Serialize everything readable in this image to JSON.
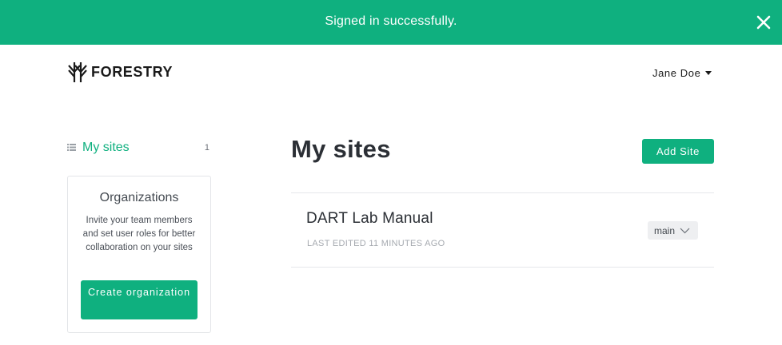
{
  "notification": {
    "message": "Signed in successfully.",
    "close_icon": "close-icon",
    "color": "#0fb07f"
  },
  "header": {
    "logo_text": "FORESTRY",
    "logo_icon": "forestry-tree-icon",
    "user_name": "Jane Doe",
    "user_caret_icon": "caret-down-icon"
  },
  "sidebar": {
    "nav": {
      "label": "My sites",
      "count": "1",
      "icon": "list-icon"
    },
    "organizations": {
      "title": "Organizations",
      "description": "Invite your team members and set user roles for better collaboration on your sites",
      "button_label": "Create organization"
    }
  },
  "main": {
    "title": "My sites",
    "add_button_label": "Add Site",
    "sites": [
      {
        "name": "DART Lab Manual",
        "meta": "LAST EDITED 11 MINUTES AGO",
        "branch": "main",
        "branch_icon": "chevron-down-icon"
      }
    ]
  },
  "colors": {
    "accent": "#0fb07f",
    "text": "#33373d",
    "muted": "#a6aab0"
  }
}
